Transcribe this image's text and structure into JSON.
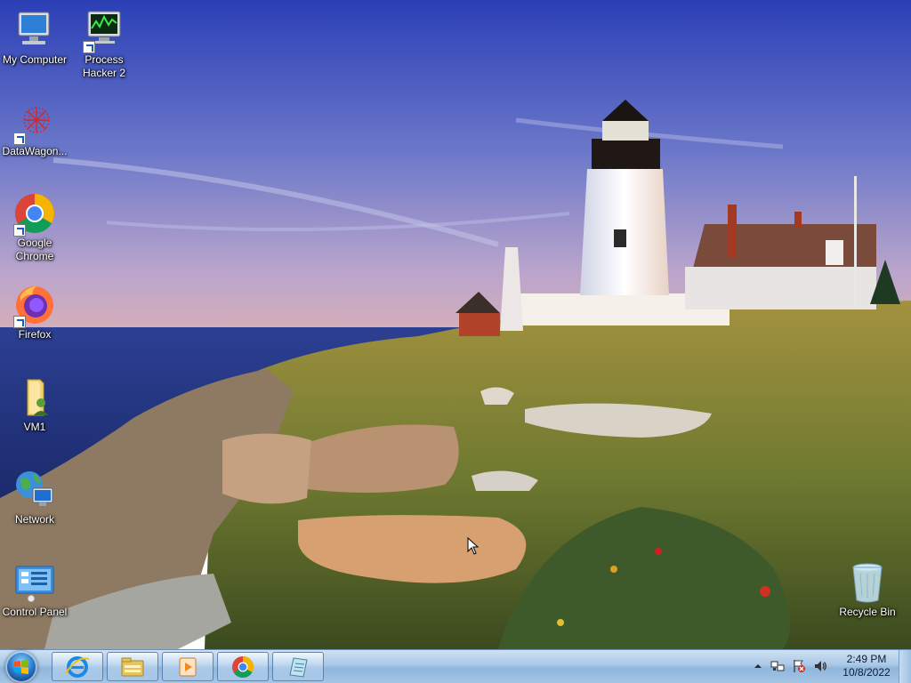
{
  "desktop": {
    "icons": [
      {
        "label": "My Computer",
        "icon": "computer-icon"
      },
      {
        "label": "Process Hacker 2",
        "icon": "process-hacker-icon"
      },
      {
        "label": "DataWagon...",
        "icon": "datawagon-icon"
      },
      {
        "label": "Google Chrome",
        "icon": "chrome-icon"
      },
      {
        "label": "Firefox",
        "icon": "firefox-icon"
      },
      {
        "label": "VM1",
        "icon": "folder-user-icon"
      },
      {
        "label": "Network",
        "icon": "network-icon"
      },
      {
        "label": "Control Panel",
        "icon": "control-panel-icon"
      },
      {
        "label": "Recycle Bin",
        "icon": "recycle-bin-icon"
      }
    ]
  },
  "taskbar": {
    "pinned": [
      {
        "name": "Internet Explorer",
        "icon": "ie-icon"
      },
      {
        "name": "Windows Explorer",
        "icon": "explorer-icon"
      },
      {
        "name": "Windows Media Player",
        "icon": "media-player-icon"
      },
      {
        "name": "Google Chrome",
        "icon": "chrome-icon"
      },
      {
        "name": "Notepad",
        "icon": "notepad-icon"
      }
    ],
    "clock": {
      "time": "2:49 PM",
      "date": "10/8/2022"
    }
  },
  "colors": {
    "sky_top": "#2e44b8",
    "sky_bottom": "#c7a6c9",
    "sea": "#21378a",
    "grass": "#8a8a3a",
    "taskbar": "#a9c8e6"
  }
}
